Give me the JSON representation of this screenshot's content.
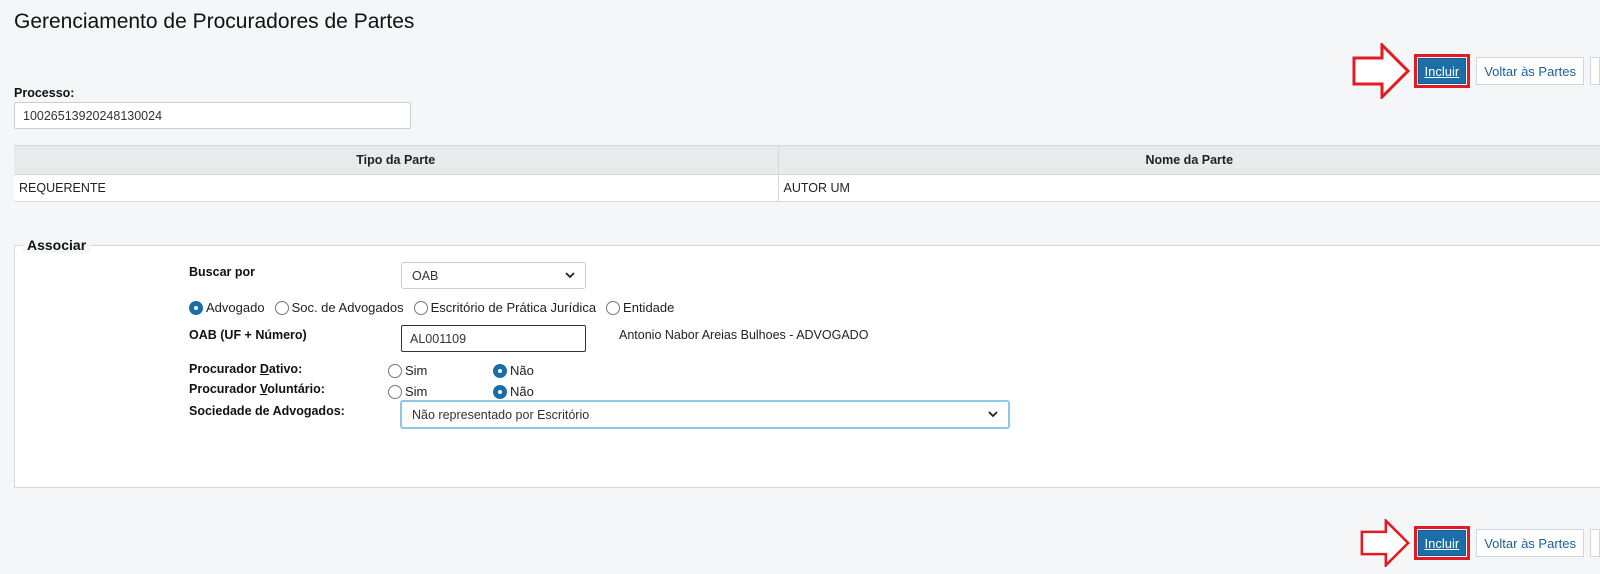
{
  "page": {
    "title": "Gerenciamento de Procuradores de Partes"
  },
  "actions": {
    "incluir_label": "Incluir",
    "voltar_label": "Voltar às Partes",
    "arrow_color": "#e01b24",
    "primary_color": "#1b6ea8"
  },
  "processo": {
    "label": "Processo:",
    "value": "10026513920248130024"
  },
  "parts_table": {
    "columns": [
      "Tipo da Parte",
      "Nome da Parte"
    ],
    "rows": [
      {
        "tipo": "REQUERENTE",
        "nome": "AUTOR UM"
      }
    ]
  },
  "associar": {
    "legend": "Associar",
    "buscar_por": {
      "label": "Buscar por",
      "value": "OAB"
    },
    "tipo_options": [
      {
        "label": "Advogado",
        "selected": true
      },
      {
        "label": "Soc. de Advogados",
        "selected": false
      },
      {
        "label": "Escritório de Prática Jurídica",
        "selected": false
      },
      {
        "label": "Entidade",
        "selected": false
      }
    ],
    "oab": {
      "label": "OAB (UF + Número)",
      "value": "AL001109",
      "result": "Antonio Nabor Areias Bulhoes - ADVOGADO"
    },
    "dativo": {
      "label": "Procurador Dativo:",
      "sim": "Sim",
      "nao": "Não",
      "value": "Não"
    },
    "voluntario": {
      "label": "Procurador Voluntário:",
      "sim": "Sim",
      "nao": "Não",
      "value": "Não"
    },
    "sociedade": {
      "label": "Sociedade de Advogados:",
      "value": "Não representado por Escritório"
    }
  }
}
